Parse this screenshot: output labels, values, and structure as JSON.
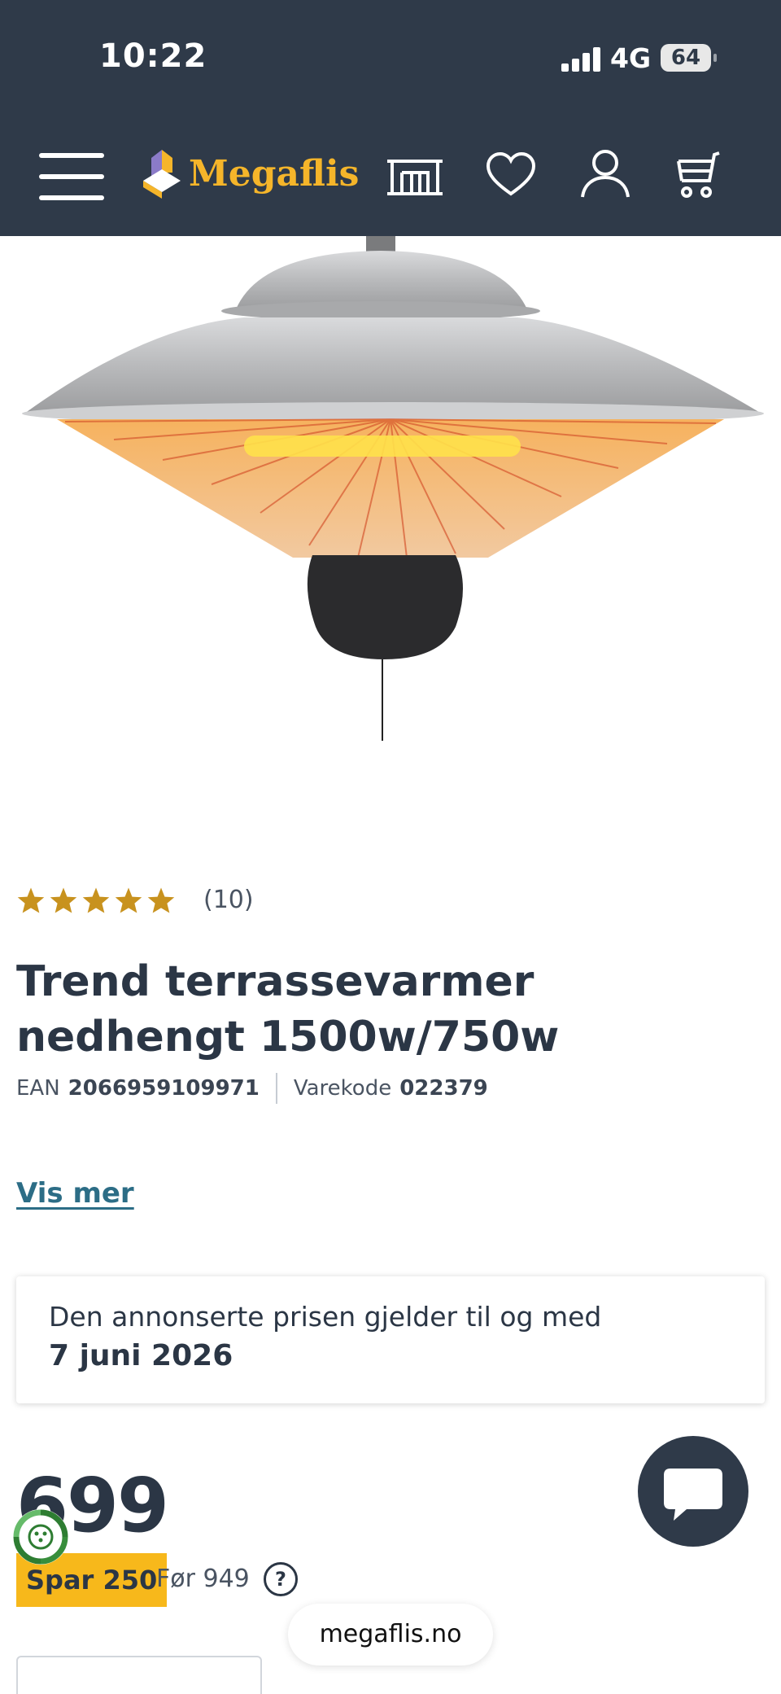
{
  "status_bar": {
    "time": "10:22",
    "network": "4G",
    "battery": "64"
  },
  "header": {
    "brand": "Megaflis",
    "icons": [
      "menu-icon",
      "showroom-icon",
      "heart-icon",
      "user-icon",
      "cart-icon"
    ]
  },
  "product": {
    "rating": {
      "stars": 5,
      "count": "(10)"
    },
    "title": "Trend terrassevarmer nedhengt 1500w/750w",
    "ean_label": "EAN",
    "ean": "2066959109971",
    "sku_label": "Varekode",
    "sku": "022379",
    "show_more": "Vis mer"
  },
  "price_notice": {
    "text": "Den annonserte prisen gjelder til og med",
    "date": "7 juni 2026"
  },
  "pricing": {
    "price": "699",
    "save_label": "Spar 250",
    "before_label": "Før 949",
    "help": "?"
  },
  "browser": {
    "url": "megaflis.no"
  },
  "colors": {
    "header_bg": "#2f3a49",
    "brand_yellow": "#f5b52a",
    "save_badge": "#f7b81b",
    "link": "#2c6d86",
    "star": "#c8921e"
  }
}
